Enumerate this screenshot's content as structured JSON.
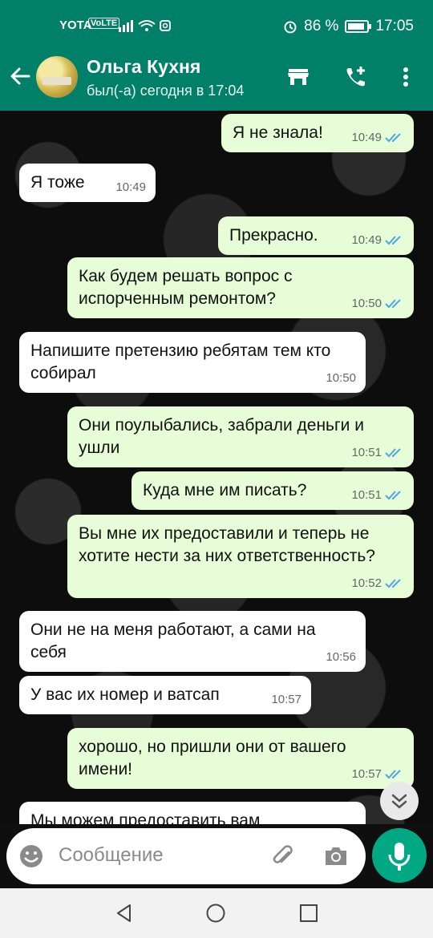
{
  "status": {
    "carrier": "YOTA",
    "volte": "VoLTE",
    "battery": "86 %",
    "time": "17:05"
  },
  "header": {
    "title": "Ольга Кухня",
    "subtitle": "был(-а) сегодня в 17:04"
  },
  "messages": [
    {
      "dir": "out",
      "text": "Я не знала!",
      "time": "10:49"
    },
    {
      "dir": "in",
      "text": "Я тоже",
      "time": "10:49"
    },
    {
      "dir": "out",
      "text": "Прекрасно.",
      "time": "10:49"
    },
    {
      "dir": "out",
      "text": "Как будем решать вопрос  с испорченным ремонтом?",
      "time": "10:50"
    },
    {
      "dir": "in",
      "text": "Напишите претензию ребятам тем кто собирал",
      "time": "10:50"
    },
    {
      "dir": "out",
      "text": "Они поулыбались, забрали деньги и ушли",
      "time": "10:51"
    },
    {
      "dir": "out",
      "text": "Куда мне им писать?",
      "time": "10:51"
    },
    {
      "dir": "out",
      "text": "Вы мне их предоставили и теперь не хотите нести за них ответственность?",
      "time": "10:52"
    },
    {
      "dir": "in",
      "text": "Они не на меня работают, а сами на себя",
      "time": "10:56"
    },
    {
      "dir": "in",
      "text": "У вас их номер и ватсап",
      "time": "10:57"
    },
    {
      "dir": "out",
      "text": "хорошо, но пришли они от вашего имени!",
      "time": "10:57"
    },
    {
      "dir": "in",
      "text": "Мы можем предоставить вам",
      "time": ""
    }
  ],
  "input": {
    "placeholder": "Сообщение"
  },
  "colors": {
    "header": "#008069",
    "outgoing": "#e7fdd8",
    "incoming": "#ffffff",
    "tick": "#4fa6e6",
    "mic": "#00a884"
  }
}
